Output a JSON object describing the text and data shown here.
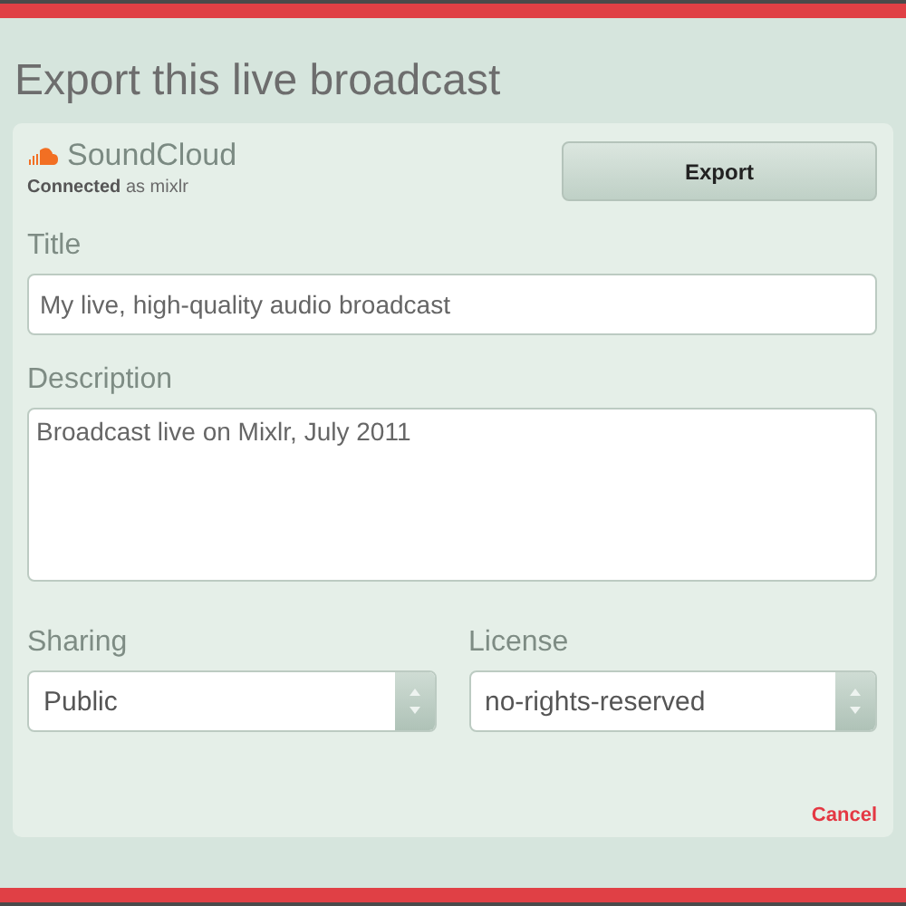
{
  "dialog": {
    "title": "Export this live broadcast"
  },
  "service": {
    "name": "SoundCloud",
    "status": "**Connected** as mixlr"
  },
  "export_button": "Export",
  "fields": [
    {
      "kind": "input",
      "label": "Title",
      "value": "My live, high-quality audio broadcast"
    },
    {
      "kind": "textarea",
      "label": "Description",
      "value": "Broadcast live on Mixlr, July 2011"
    }
  ],
  "selects": [
    {
      "label": "Sharing",
      "value": "Public"
    },
    {
      "label": "License",
      "value": "no-rights-reserved"
    }
  ],
  "cancel": "Cancel"
}
